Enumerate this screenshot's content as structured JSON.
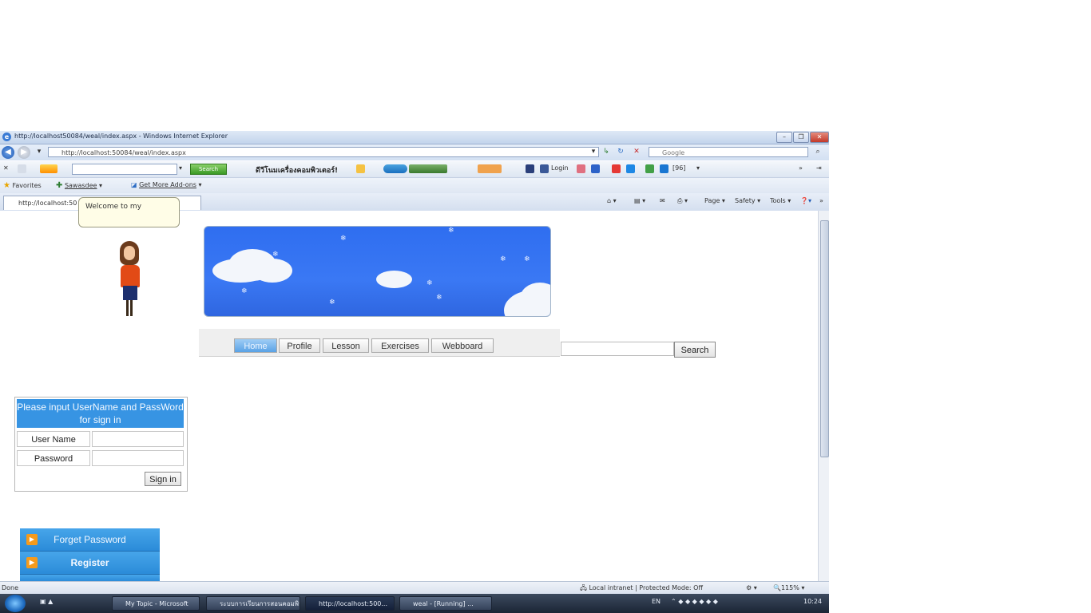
{
  "window": {
    "title": "http://localhost50084/weal/index.aspx - Windows Internet Explorer",
    "address": "http://localhost:50084/weal/index.aspx",
    "search_placeholder": "Google"
  },
  "toolbar": {
    "gsearch_label": "Search",
    "thai_text": "ดีวีโนมเครื่องคอมพิวเตอร์!",
    "badge": "[96]",
    "face_label": "Login"
  },
  "favorites": {
    "label": "Favorites",
    "item1": "Sawasdee",
    "item2": "Get More Add-ons"
  },
  "tab": {
    "label": "http://localhost:50"
  },
  "commandbar": {
    "page": "Page",
    "safety": "Safety",
    "tools": "Tools"
  },
  "tooltip": {
    "text": "Welcome to my"
  },
  "nav": {
    "items": [
      "Home",
      "Profile",
      "Lesson",
      "Exercises",
      "Webboard"
    ]
  },
  "search": {
    "button": "Search"
  },
  "login": {
    "heading": "Please input UserName and PassWord for sign in",
    "username_label": "User Name",
    "password_label": "Password",
    "signin_label": "Sign in"
  },
  "sidebar": {
    "forget": "Forget Password",
    "register": "Register"
  },
  "status": {
    "left": "Done",
    "zone": "Local intranet | Protected Mode: Off",
    "zoom": "115%"
  },
  "taskbar": {
    "items": [
      "My Topic - Microsoft",
      "ระบบการเรียนการสอนคอมพิวเตอร์...",
      "http://localhost:500...",
      "weal - [Running] ..."
    ],
    "lang": "EN",
    "clock": "10:24"
  }
}
